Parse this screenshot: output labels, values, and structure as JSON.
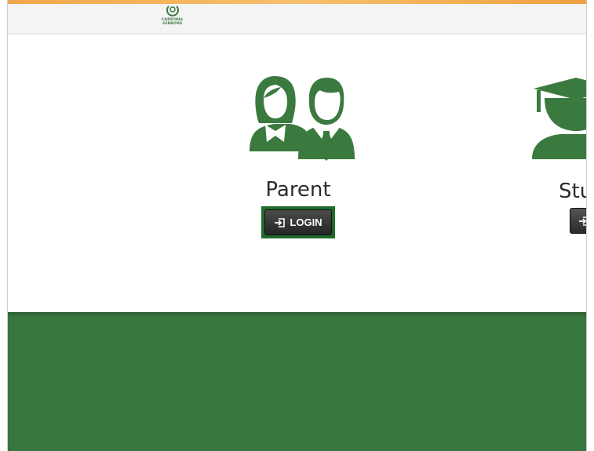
{
  "header": {
    "logo_lines": [
      "CARDINAL",
      "GIBBONS"
    ]
  },
  "roles": {
    "parent": {
      "label": "Parent",
      "login_label": "LOGIN",
      "icon": "parent-couple-icon"
    },
    "student": {
      "label": "Stu",
      "icon": "graduate-icon"
    }
  },
  "icons": {
    "login": "sign-in-icon"
  },
  "colors": {
    "brand_green": "#37773e",
    "icon_green": "#3b7a3f",
    "accent_orange": "#f2a64b",
    "button_dark": "#2f2f2f",
    "focus_border": "#1f6b2b"
  }
}
